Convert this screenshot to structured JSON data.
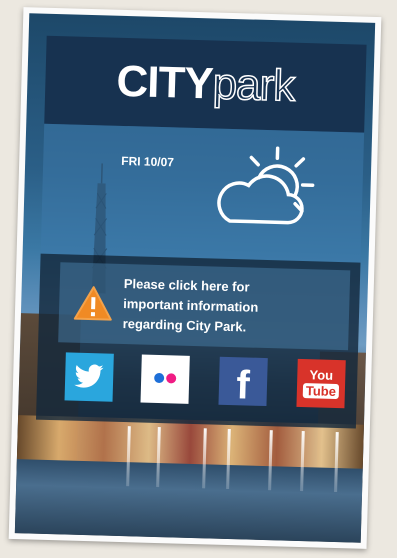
{
  "header": {
    "logo_city": "CITY",
    "logo_park": "park"
  },
  "weather": {
    "date": "FRI 10/07",
    "icon": "partly-cloudy-icon"
  },
  "notice": {
    "text_line1": "Please click here for",
    "text_line2": "important information",
    "text_line3": "regarding City Park.",
    "icon": "warning-icon",
    "icon_color": "#f08a24"
  },
  "social": [
    {
      "name": "twitter",
      "icon": "twitter-icon",
      "color": "#2aa6dd"
    },
    {
      "name": "flickr",
      "icon": "flickr-icon",
      "color": "#ffffff"
    },
    {
      "name": "facebook",
      "icon": "facebook-icon",
      "label": "f",
      "color": "#3a5998"
    },
    {
      "name": "youtube",
      "icon": "youtube-icon",
      "label_top": "You",
      "label_bottom": "Tube",
      "color": "#d8332a"
    }
  ],
  "colors": {
    "header_bg": "#173250",
    "accent": "#2b5f87"
  }
}
